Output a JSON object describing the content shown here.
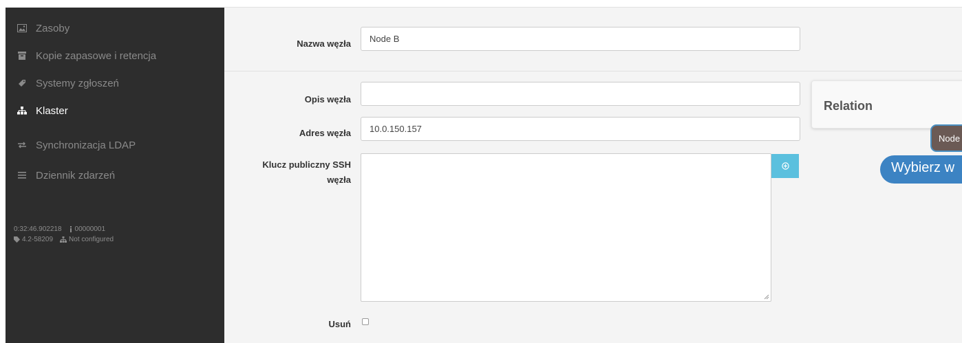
{
  "sidebar": {
    "items": [
      {
        "label": "Zasoby",
        "icon": "image-icon",
        "active": false
      },
      {
        "label": "Kopie zapasowe i retencja",
        "icon": "archive-icon",
        "active": false
      },
      {
        "label": "Systemy zgłoszeń",
        "icon": "ticket-icon",
        "active": false
      },
      {
        "label": "Klaster",
        "icon": "sitemap-icon",
        "active": true
      },
      {
        "label": "Synchronizacja LDAP",
        "icon": "exchange-icon",
        "active": false
      },
      {
        "label": "Dziennik zdarzeń",
        "icon": "list-icon",
        "active": false
      }
    ],
    "meta": {
      "time": "0:32:46.902218",
      "id": "00000001",
      "version": "4.2-58209",
      "cluster_status": "Not configured"
    }
  },
  "form": {
    "node_name": {
      "label": "Nazwa węzła",
      "value": "Node B"
    },
    "node_description": {
      "label": "Opis węzła",
      "value": ""
    },
    "node_address": {
      "label": "Adres węzła",
      "value": "10.0.150.157"
    },
    "ssh_key": {
      "label_line1": "Klucz publiczny SSH",
      "label_line2": "węzła",
      "value": ""
    },
    "delete": {
      "label": "Usuń",
      "checked": false
    }
  },
  "relation": {
    "title": "Relation",
    "node_chip": "Node",
    "choose_bubble": "Wybierz w"
  },
  "colors": {
    "sidebar_bg": "#2d2d2d",
    "form_bg": "#f4f4f4",
    "add_button": "#5bc0de",
    "bubble": "#3c83c3",
    "chip": "#6b5a55"
  }
}
